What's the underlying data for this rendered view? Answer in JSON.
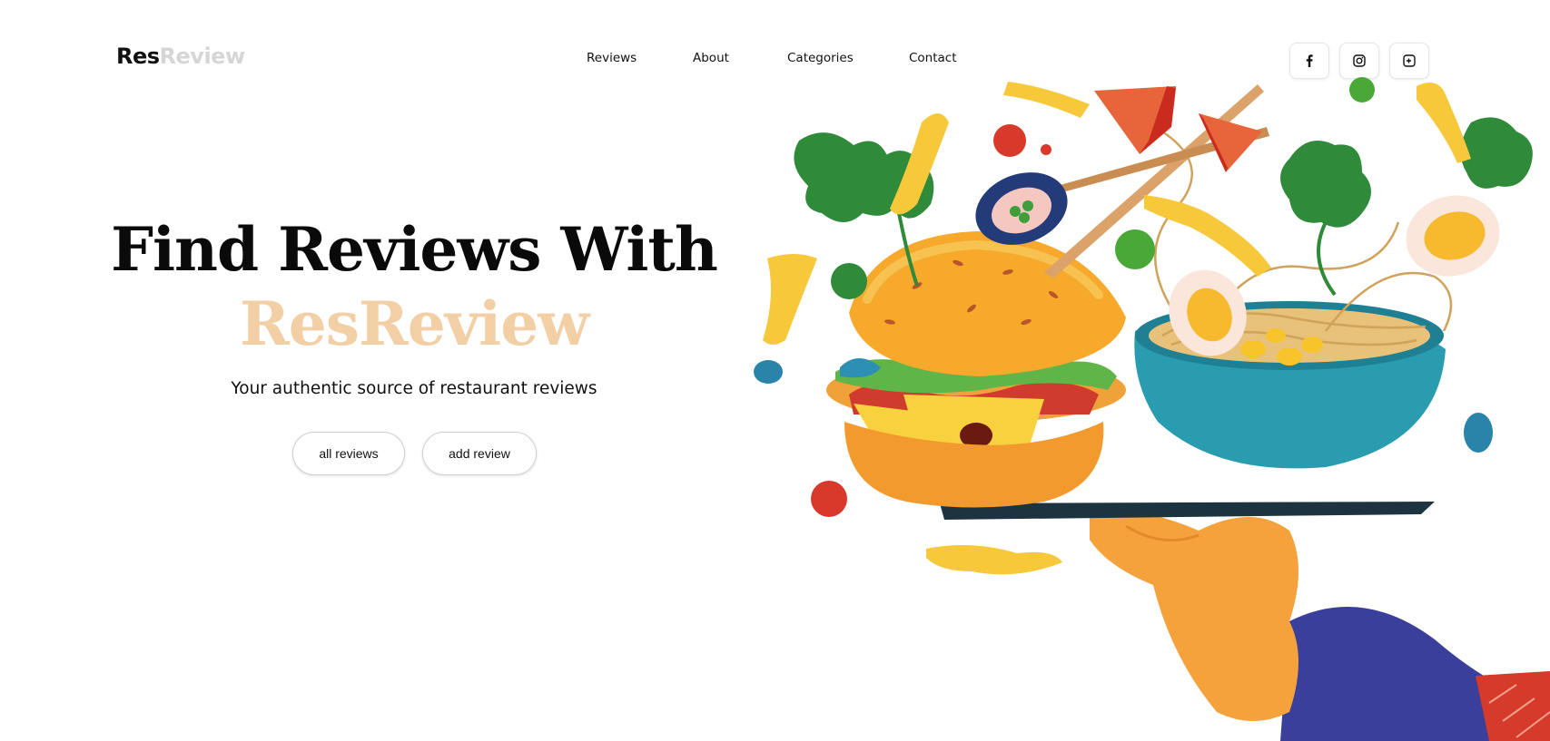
{
  "brand": {
    "logo_part1": "Res",
    "logo_part2": "Review"
  },
  "nav": {
    "items": [
      {
        "label": "Reviews"
      },
      {
        "label": "About"
      },
      {
        "label": "Categories"
      },
      {
        "label": "Contact"
      }
    ]
  },
  "social": [
    {
      "icon": "facebook-icon"
    },
    {
      "icon": "instagram-icon"
    },
    {
      "icon": "google-plus-icon"
    }
  ],
  "hero": {
    "title_line1": "Find Reviews With",
    "title_line2": "ResReview",
    "subtitle": "Your authentic source of restaurant reviews",
    "primary_button": "all reviews",
    "secondary_button": "add review"
  },
  "colors": {
    "accent": "#f2cfa4",
    "logo_muted": "#d6d6d6",
    "text": "#111111"
  }
}
